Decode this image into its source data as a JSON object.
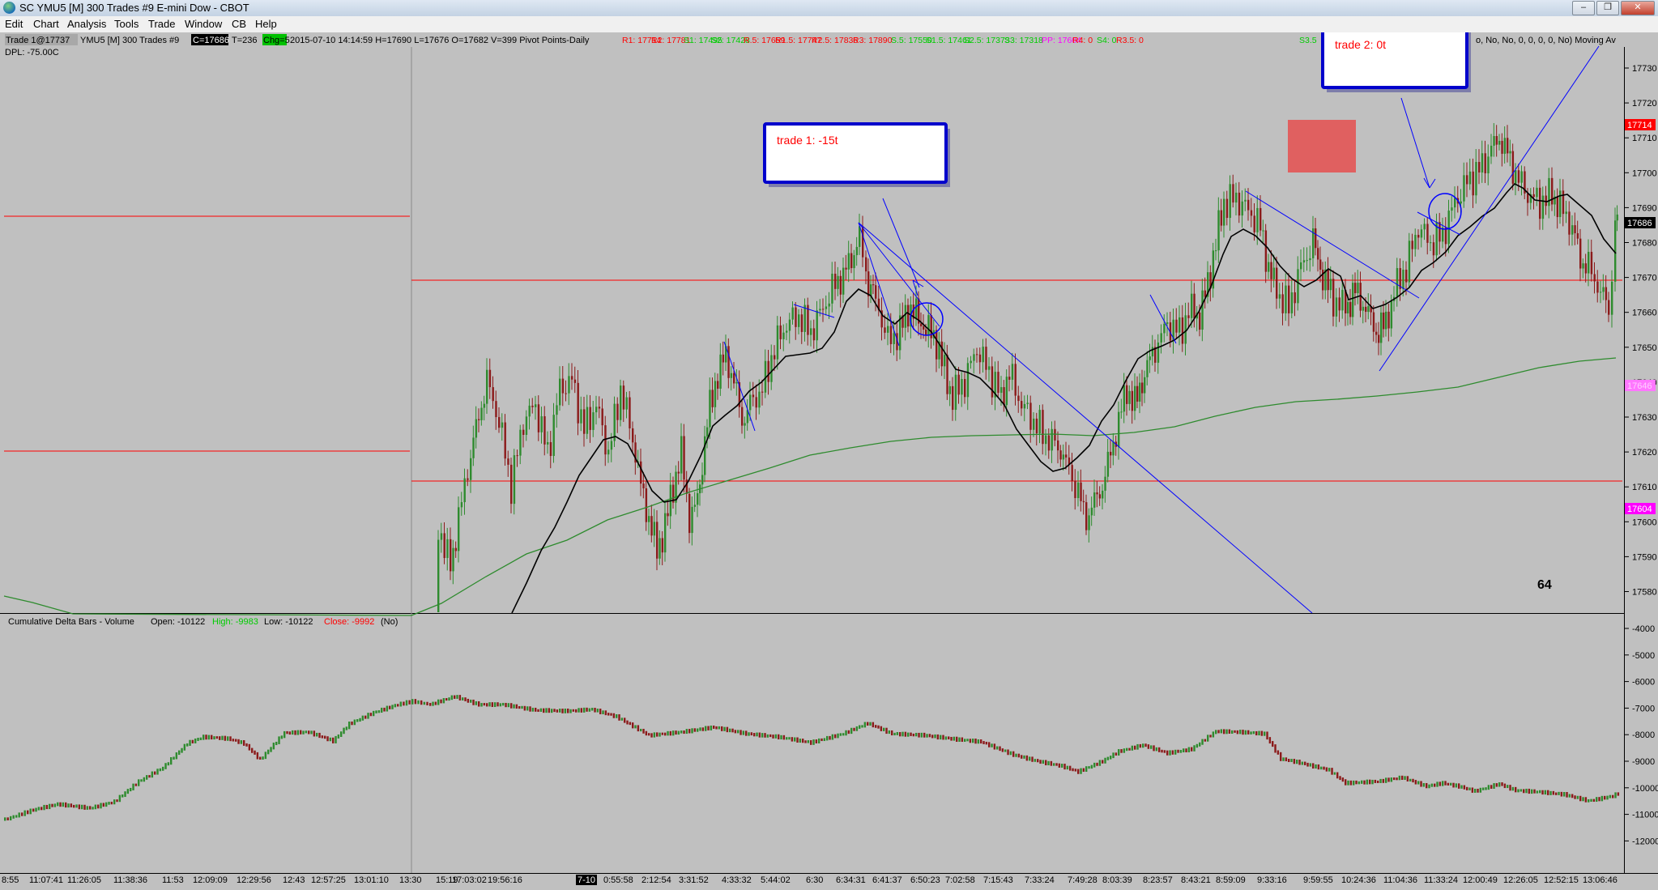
{
  "window": {
    "title": "SC YMU5 [M]  300 Trades  #9  E-mini Dow - CBOT",
    "minimize": "–",
    "maximize": "❐",
    "close": "✕"
  },
  "menu": {
    "items": [
      "Edit",
      "Chart",
      "Analysis",
      "Tools",
      "Trade",
      "Window",
      "CB",
      "Help"
    ]
  },
  "colors": {
    "background": "#c0c0c0",
    "up_bar": "#2e8b2e",
    "down_bar": "#8b1a1a",
    "pivot_line": "#ff0000",
    "trendline": "#0000ff",
    "ma_fast": "#000000",
    "ma_slow": "#2e8b2e",
    "pp_magenta": "#ff00ff"
  },
  "top_info": {
    "trade_label": "Trade 1@17737",
    "symbol": "YMU5 [M]  300 Trades #9",
    "last_price": "C=17686",
    "ticks": "T=236",
    "change": "Chg=5",
    "bar_info": "2015-07-10 14:14:59 H=17690 L=17676 O=17682 V=399 Pivot Points-Daily",
    "pivots": [
      {
        "text": "R1: 17714",
        "color": "#ff0000"
      },
      {
        "text": "R2: 17781",
        "color": "#ff0000"
      },
      {
        "text": "S1: 17495",
        "color": "#00cc00"
      },
      {
        "text": "S2: 17428",
        "color": "#00cc00"
      },
      {
        "text": "R.5: 17659",
        "color": "#ff0000"
      },
      {
        "text": "R1.5: 17747",
        "color": "#ff0000"
      },
      {
        "text": "R2.5: 17836",
        "color": "#ff0000"
      },
      {
        "text": "R3: 17890",
        "color": "#ff0000"
      },
      {
        "text": "S.5: 17550",
        "color": "#00cc00"
      },
      {
        "text": "S1.5: 17461",
        "color": "#00cc00"
      },
      {
        "text": "S2.5: 17373",
        "color": "#00cc00"
      },
      {
        "text": "S3: 17318",
        "color": "#00cc00"
      },
      {
        "text": "PP: 17604",
        "color": "#ff00ff"
      },
      {
        "text": "R4: 0",
        "color": "#ff0000"
      },
      {
        "text": "S4: 0",
        "color": "#00cc00"
      },
      {
        "text": "R3.5: 0",
        "color": "#ff0000"
      },
      {
        "text": "S3.5",
        "color": "#00cc00"
      }
    ],
    "right_text": "o, No, No, 0, 0, 0, 0, No)   Moving Av",
    "dpl": "DPL: -75.00C"
  },
  "annotations": {
    "trade1": "trade 1: -15t",
    "trade2": "trade 2: 0t",
    "number": "64"
  },
  "price_axis": {
    "ticks": [
      "17730",
      "17720",
      "17710",
      "17700",
      "17690",
      "17680",
      "17670",
      "17660",
      "17650",
      "17640",
      "17630",
      "17620",
      "17610",
      "17600",
      "17590",
      "17580"
    ],
    "marker_r1": "17714",
    "marker_last": "17686",
    "marker_pp": "17604",
    "marker_ma": "17646"
  },
  "delta_panel": {
    "title": "Cumulative Delta Bars - Volume",
    "open": "Open: -10122",
    "high": "High: -9983",
    "low": "Low: -10122",
    "close": "Close: -9992",
    "no": "(No)",
    "ticks": [
      "-4000",
      "-5000",
      "-6000",
      "-7000",
      "-8000",
      "-9000",
      "-10000",
      "-11000",
      "-12000"
    ]
  },
  "time_axis": {
    "labels": [
      "8:55",
      "11:07:41",
      "11:26:05",
      "11:38:36",
      "11:53",
      "12:09:09",
      "12:29:56",
      "12:43",
      "12:57:25",
      "13:01:10",
      "13:30",
      "15:19",
      "17:03:02",
      "19:56:16",
      "7-10",
      "0:55:58",
      "2:12:54",
      "3:31:52",
      "4:33:32",
      "5:44:02",
      "6:30",
      "6:34:31",
      "6:41:37",
      "6:50:23",
      "7:02:58",
      "7:15:43",
      "7:33:24",
      "7:49:28",
      "8:03:39",
      "8:23:57",
      "8:43:21",
      "8:59:09",
      "9:33:16",
      "9:59:55",
      "10:24:36",
      "11:04:36",
      "11:33:24",
      "12:00:49",
      "12:26:05",
      "12:52:15",
      "13:06:46"
    ]
  }
}
